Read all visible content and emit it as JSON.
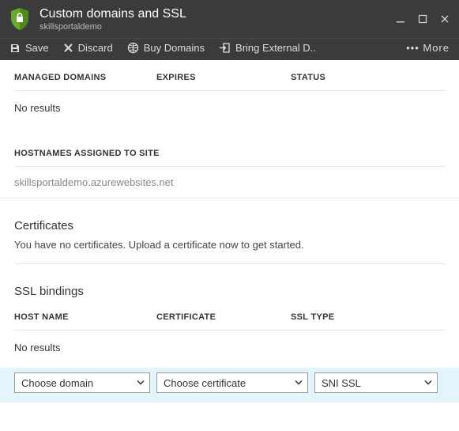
{
  "header": {
    "title": "Custom domains and SSL",
    "subtitle": "skillsportaldemo"
  },
  "toolbar": {
    "save": "Save",
    "discard": "Discard",
    "buy_domains": "Buy Domains",
    "bring_external": "Bring External D..",
    "more": "More"
  },
  "managed_domains": {
    "headers": {
      "domains": "MANAGED DOMAINS",
      "expires": "EXPIRES",
      "status": "STATUS"
    },
    "empty": "No results"
  },
  "hostnames_section": {
    "title": "HOSTNAMES ASSIGNED TO SITE",
    "hostname": "skillsportaldemo.azurewebsites.net"
  },
  "certificates": {
    "title": "Certificates",
    "desc": "You have no certificates. Upload a certificate now to get started."
  },
  "ssl_bindings": {
    "title": "SSL bindings",
    "headers": {
      "hostname": "HOST NAME",
      "certificate": "CERTIFICATE",
      "ssltype": "SSL TYPE"
    },
    "empty": "No results",
    "selects": {
      "domain": "Choose domain",
      "certificate": "Choose certificate",
      "ssltype": "SNI SSL"
    }
  }
}
